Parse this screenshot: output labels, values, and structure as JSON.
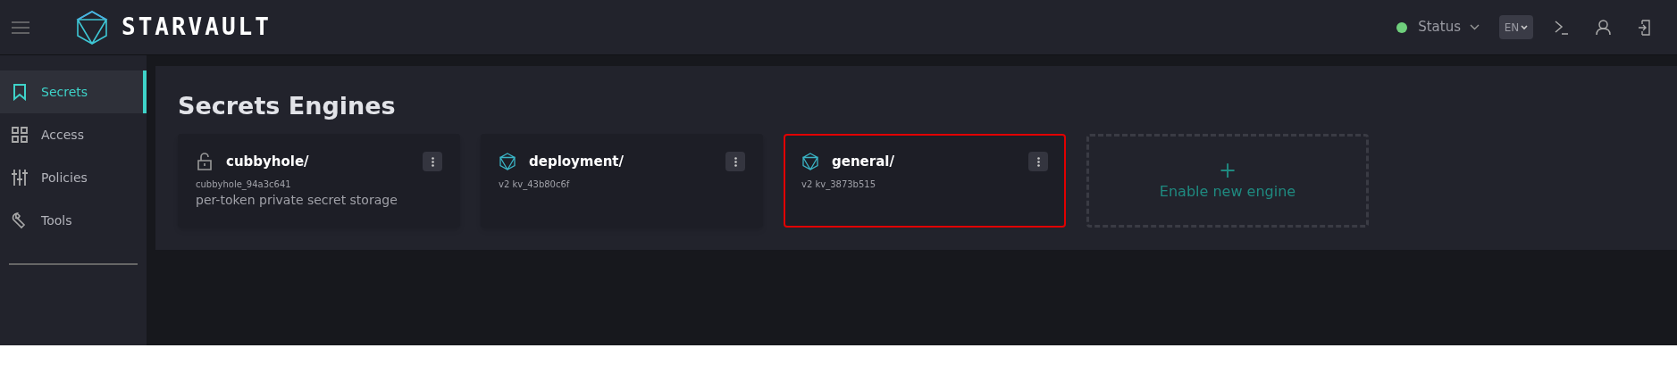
{
  "header": {
    "brand": "STARVAULT",
    "status": {
      "label": "Status",
      "color": "#6fcf7c"
    },
    "language": "EN"
  },
  "sidebar": {
    "items": [
      {
        "label": "Secrets",
        "selected": true
      },
      {
        "label": "Access",
        "selected": false
      },
      {
        "label": "Policies",
        "selected": false
      },
      {
        "label": "Tools",
        "selected": false
      }
    ]
  },
  "page": {
    "title": "Secrets Engines",
    "cards": [
      {
        "kind": "cubbyhole",
        "name": "cubbyhole/",
        "subtitle": "cubbyhole_94a3c641",
        "description": "per-token private secret storage",
        "highlighted": false
      },
      {
        "kind": "kv",
        "name": "deployment/",
        "subtitle": "v2 kv_43b80c6f",
        "highlighted": false
      },
      {
        "kind": "kv",
        "name": "general/",
        "subtitle": "v2 kv_3873b515",
        "highlighted": true
      },
      {
        "kind": "add",
        "icon": "+",
        "name": "Enable new engine"
      }
    ]
  }
}
